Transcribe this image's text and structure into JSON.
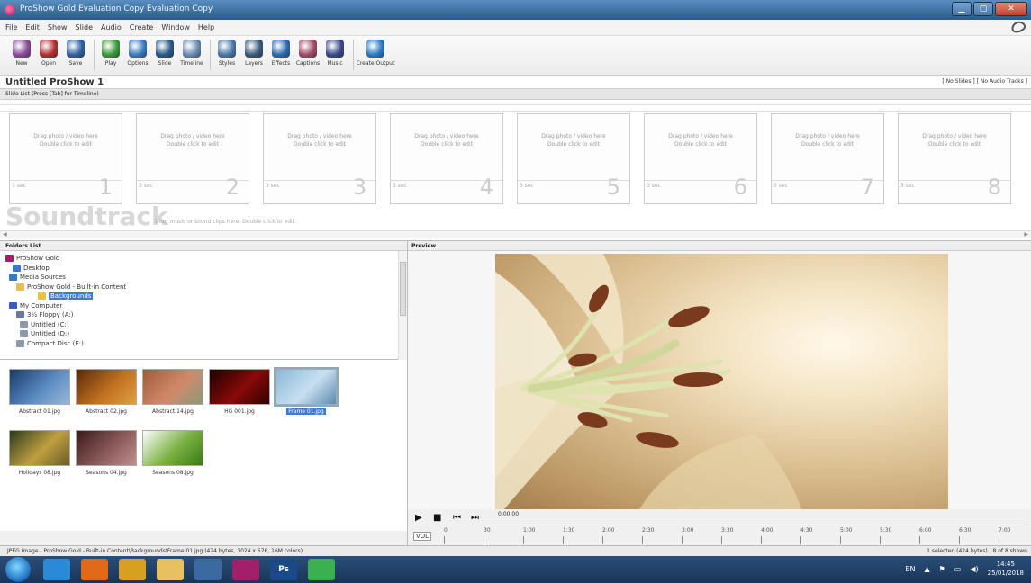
{
  "window": {
    "title": "ProShow Gold   Evaluation Copy   Evaluation Copy",
    "controls": [
      "minimize",
      "maximize",
      "close"
    ]
  },
  "menu": [
    "File",
    "Edit",
    "Show",
    "Slide",
    "Audio",
    "Create",
    "Window",
    "Help"
  ],
  "toolbar": [
    {
      "label": "New",
      "icon": "new-icon",
      "color": "#8a4a9a"
    },
    {
      "label": "Open",
      "icon": "open-icon",
      "color": "#b03030"
    },
    {
      "label": "Save",
      "icon": "save-icon",
      "color": "#3060a0"
    },
    {
      "label": "Play",
      "icon": "play-icon",
      "color": "#3a9a3a"
    },
    {
      "label": "Options",
      "icon": "options-icon",
      "color": "#3a7ac0"
    },
    {
      "label": "Slide",
      "icon": "slide-icon",
      "color": "#2a5a8a"
    },
    {
      "label": "Timeline",
      "icon": "timeline-icon",
      "color": "#6a8ab0"
    },
    {
      "label": "Styles",
      "icon": "styles-icon",
      "color": "#4a7aaa"
    },
    {
      "label": "Layers",
      "icon": "layers-icon",
      "color": "#3a5a7a"
    },
    {
      "label": "Effects",
      "icon": "effects-icon",
      "color": "#2a6ab0"
    },
    {
      "label": "Captions",
      "icon": "captions-icon",
      "color": "#a04a6a"
    },
    {
      "label": "Music",
      "icon": "music-icon",
      "color": "#3a4a8a"
    },
    {
      "label": "Create Output",
      "icon": "create-output-icon",
      "color": "#2a7ac0"
    }
  ],
  "show": {
    "name": "Untitled ProShow 1",
    "info": "[ No Slides ]  [ No Audio Tracks ]"
  },
  "slide_list": {
    "header": "Slide List (Press [Tab] for Timeline)",
    "slides": [
      {
        "drag": "Drag photo / video here",
        "dbl": "Double click to edit",
        "time": "3 sec",
        "num": "1"
      },
      {
        "drag": "Drag photo / video here",
        "dbl": "Double click to edit",
        "time": "3 sec",
        "num": "2"
      },
      {
        "drag": "Drag photo / video here",
        "dbl": "Double click to edit",
        "time": "3 sec",
        "num": "3"
      },
      {
        "drag": "Drag photo / video here",
        "dbl": "Double click to edit",
        "time": "3 sec",
        "num": "4"
      },
      {
        "drag": "Drag photo / video here",
        "dbl": "Double click to edit",
        "time": "3 sec",
        "num": "5"
      },
      {
        "drag": "Drag photo / video here",
        "dbl": "Double click to edit",
        "time": "3 sec",
        "num": "6"
      },
      {
        "drag": "Drag photo / video here",
        "dbl": "Double click to edit",
        "time": "3 sec",
        "num": "7"
      },
      {
        "drag": "Drag photo / video here",
        "dbl": "Double click to edit",
        "time": "3 sec",
        "num": "8"
      }
    ],
    "soundtrack": "Soundtrack",
    "soundtrack_hint": "Drag music or sound clips here.  Double click to edit."
  },
  "folders": {
    "header": "Folders List",
    "items": [
      {
        "label": "ProShow Gold",
        "icon": "proshow-icon",
        "color": "#a0206a"
      },
      {
        "label": "Desktop",
        "icon": "desktop-icon",
        "color": "#3a7ac0"
      },
      {
        "label": "Media Sources",
        "icon": "media-sources-icon",
        "color": "#3a7ac0"
      },
      {
        "label": "ProShow Gold - Built-in Content",
        "icon": "folder-icon",
        "color": "#e8c050"
      },
      {
        "label": "Backgrounds",
        "icon": "folder-icon",
        "color": "#e8c050"
      },
      {
        "label": "My Computer",
        "icon": "computer-icon",
        "color": "#3a5ac0"
      },
      {
        "label": "3½ Floppy (A:)",
        "icon": "floppy-icon",
        "color": "#6a7a9a"
      },
      {
        "label": "Untitled (C:)",
        "icon": "drive-icon",
        "color": "#8a9aaa"
      },
      {
        "label": "Untitled (D:)",
        "icon": "drive-icon",
        "color": "#8a9aaa"
      },
      {
        "label": "Compact Disc (E:)",
        "icon": "cd-icon",
        "color": "#8a9aaa"
      }
    ]
  },
  "thumbnails": [
    {
      "caption": "Abstract 01.jpg",
      "colors": [
        "#1a3a6a",
        "#5a8ac0",
        "#9ab8d8"
      ]
    },
    {
      "caption": "Abstract 02.jpg",
      "colors": [
        "#5a2a0a",
        "#c07020",
        "#e0a040"
      ]
    },
    {
      "caption": "Abstract 14.jpg",
      "colors": [
        "#a05a3a",
        "#d08a6a",
        "#8a9a7a"
      ]
    },
    {
      "caption": "HG 001.jpg",
      "colors": [
        "#1a0000",
        "#8a0a0a",
        "#300000"
      ]
    },
    {
      "caption": "Frame 01.jpg",
      "colors": [
        "#8ab8d8",
        "#c8e0f0",
        "#5a8ab0"
      ]
    },
    {
      "caption": "Holidays 08.jpg",
      "colors": [
        "#2a3a1a",
        "#c0a040",
        "#6a5a2a"
      ]
    },
    {
      "caption": "Seasons 04.jpg",
      "colors": [
        "#3a1a1a",
        "#8a5a5a",
        "#c09090"
      ]
    },
    {
      "caption": "Seasons 08.jpg",
      "colors": [
        "#ffffff",
        "#7ab040",
        "#3a7a1a"
      ]
    }
  ],
  "preview": {
    "header": "Preview",
    "timecode": "0:00.00",
    "volume_label": "VOL"
  },
  "timeline_ticks": [
    "0",
    "30",
    "1:00",
    "1:30",
    "2:00",
    "2:30",
    "3:00",
    "3:30",
    "4:00",
    "4:30",
    "5:00",
    "5:30",
    "6:00",
    "6:30",
    "7:00"
  ],
  "status": {
    "left": "JPEG Image - ProShow Gold - Built-in Content\\Backgrounds\\Frame 01.jpg (424 bytes, 1024 x 576, 16M colors)",
    "right": "1 selected (424 bytes) | 8 of 8 shown"
  },
  "taskbar": {
    "apps": [
      {
        "name": "start",
        "color": "#1a6bbf"
      },
      {
        "name": "internet-explorer",
        "color": "#2a8ad8"
      },
      {
        "name": "media-player",
        "color": "#e06a1a"
      },
      {
        "name": "chrome",
        "color": "#d8a020"
      },
      {
        "name": "explorer",
        "color": "#e8c060"
      },
      {
        "name": "document-app",
        "color": "#3a6aa0"
      },
      {
        "name": "proshow",
        "color": "#a0206a"
      },
      {
        "name": "photoshop",
        "color": "#1a4a8a",
        "label": "Ps"
      },
      {
        "name": "line",
        "color": "#3ab050"
      }
    ],
    "lang": "EN",
    "time": "14:45",
    "date": "25/01/2018"
  }
}
